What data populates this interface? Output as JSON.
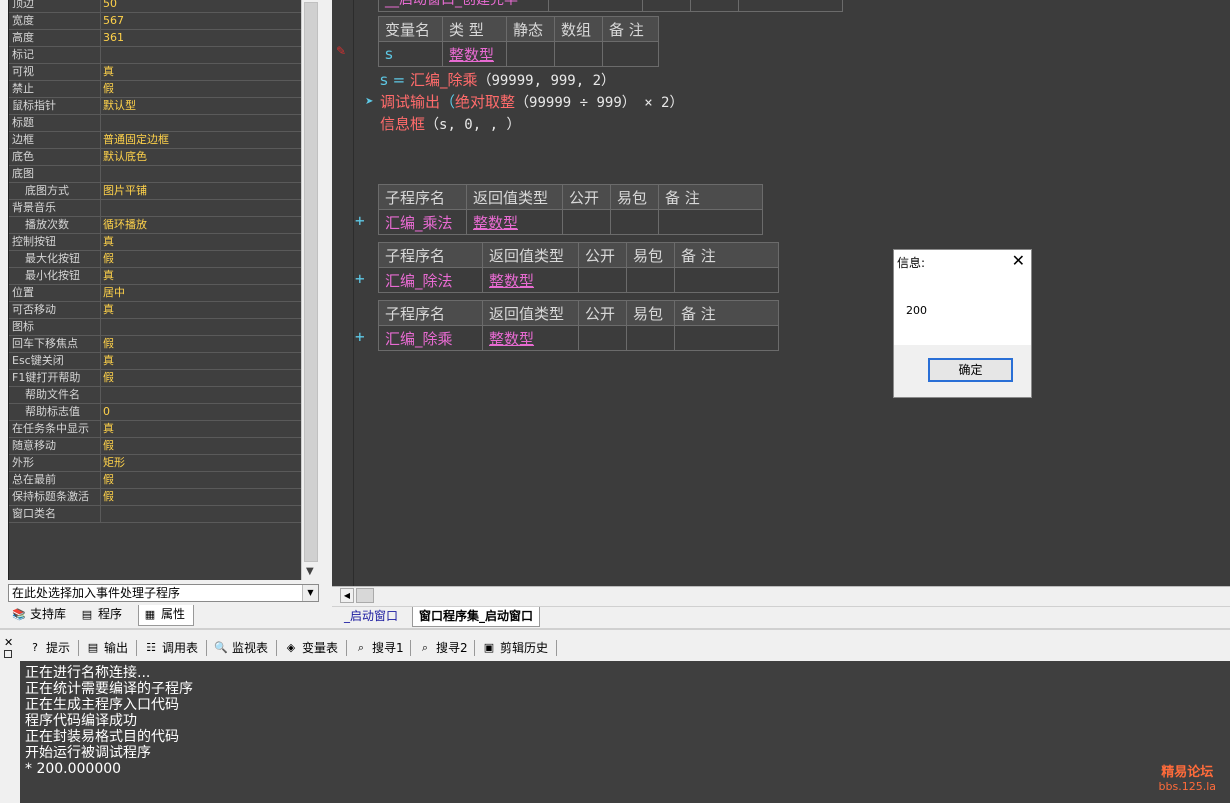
{
  "properties": [
    {
      "name": "顶边",
      "value": "50",
      "indent": false
    },
    {
      "name": "宽度",
      "value": "567",
      "indent": false
    },
    {
      "name": "高度",
      "value": "361",
      "indent": false
    },
    {
      "name": "标记",
      "value": "",
      "indent": false
    },
    {
      "name": "可视",
      "value": "真",
      "indent": false
    },
    {
      "name": "禁止",
      "value": "假",
      "indent": false
    },
    {
      "name": "鼠标指针",
      "value": "默认型",
      "indent": false
    },
    {
      "name": "标题",
      "value": "",
      "indent": false
    },
    {
      "name": "边框",
      "value": "普通固定边框",
      "indent": false
    },
    {
      "name": "底色",
      "value": "默认底色",
      "indent": false
    },
    {
      "name": "底图",
      "value": "",
      "indent": false
    },
    {
      "name": "底图方式",
      "value": "图片平铺",
      "indent": true
    },
    {
      "name": "背景音乐",
      "value": "",
      "indent": false
    },
    {
      "name": "播放次数",
      "value": "循环播放",
      "indent": true
    },
    {
      "name": "控制按钮",
      "value": "真",
      "indent": false
    },
    {
      "name": "最大化按钮",
      "value": "假",
      "indent": true
    },
    {
      "name": "最小化按钮",
      "value": "真",
      "indent": true
    },
    {
      "name": "位置",
      "value": "居中",
      "indent": false
    },
    {
      "name": "可否移动",
      "value": "真",
      "indent": false
    },
    {
      "name": "图标",
      "value": "",
      "indent": false
    },
    {
      "name": "回车下移焦点",
      "value": "假",
      "indent": false
    },
    {
      "name": "Esc键关闭",
      "value": "真",
      "indent": false
    },
    {
      "name": "F1键打开帮助",
      "value": "假",
      "indent": false
    },
    {
      "name": "帮助文件名",
      "value": "",
      "indent": true
    },
    {
      "name": "帮助标志值",
      "value": "0",
      "indent": true
    },
    {
      "name": "在任务条中显示",
      "value": "真",
      "indent": false
    },
    {
      "name": "随意移动",
      "value": "假",
      "indent": false
    },
    {
      "name": "外形",
      "value": "矩形",
      "indent": false
    },
    {
      "name": "总在最前",
      "value": "假",
      "indent": false
    },
    {
      "name": "保持标题条激活",
      "value": "假",
      "indent": false
    },
    {
      "name": "窗口类名",
      "value": "",
      "indent": false
    }
  ],
  "event_select": {
    "value": "在此处选择加入事件处理子程序"
  },
  "left_tabs": [
    {
      "label": "支持库",
      "icon": "library-icon"
    },
    {
      "label": "程序",
      "icon": "program-icon"
    },
    {
      "label": "属性",
      "icon": "property-icon"
    }
  ],
  "editor": {
    "top_row_text": "__启动窗口_创建完毕",
    "var_table": {
      "headers": [
        "变量名",
        "类 型",
        "静态",
        "数组",
        "备 注"
      ],
      "row": [
        "s",
        "整数型",
        "",
        "",
        ""
      ]
    },
    "code_lines": [
      {
        "var": "s",
        "op": " = ",
        "func": "汇编_除乘",
        "args": "（99999, 999, 2）"
      },
      {
        "prefix": "调试输出",
        "paren_open": "（",
        "func": "绝对取整",
        "args": "（99999 ÷ 999）",
        "rest": " × 2）"
      },
      {
        "prefix": "信息框",
        "args": "（s, 0, , ）"
      }
    ],
    "sub_tables": [
      {
        "headers": [
          "子程序名",
          "返回值类型",
          "公开",
          "易包",
          "备 注"
        ],
        "row": [
          "汇编_乘法",
          "整数型",
          "",
          "",
          ""
        ]
      },
      {
        "headers": [
          "子程序名",
          "返回值类型",
          "公开",
          "易包",
          "备 注"
        ],
        "row": [
          "汇编_除法",
          "整数型",
          "",
          "",
          ""
        ]
      },
      {
        "headers": [
          "子程序名",
          "返回值类型",
          "公开",
          "易包",
          "备 注"
        ],
        "row": [
          "汇编_除乘",
          "整数型",
          "",
          "",
          ""
        ]
      }
    ],
    "plus_sign": "+"
  },
  "editor_tabs": [
    {
      "label": "_启动窗口",
      "active": false
    },
    {
      "label": "窗口程序集_启动窗口",
      "active": true
    }
  ],
  "bottom_tabs": [
    {
      "label": "提示",
      "icon": "hint-icon"
    },
    {
      "label": "输出",
      "icon": "output-icon"
    },
    {
      "label": "调用表",
      "icon": "callstack-icon"
    },
    {
      "label": "监视表",
      "icon": "watch-icon"
    },
    {
      "label": "变量表",
      "icon": "variables-icon"
    },
    {
      "label": "搜寻1",
      "icon": "search1-icon"
    },
    {
      "label": "搜寻2",
      "icon": "search2-icon"
    },
    {
      "label": "剪辑历史",
      "icon": "clipboard-history-icon"
    }
  ],
  "output_lines": [
    "正在进行名称连接...",
    "正在统计需要编译的子程序",
    "正在生成主程序入口代码",
    "程序代码编译成功",
    "正在封装易格式目的代码",
    "开始运行被调试程序",
    "* 200.000000"
  ],
  "dialog": {
    "title": "信息:",
    "message": "200",
    "ok_label": "确定",
    "close_glyph": "✕"
  },
  "watermark": {
    "line1": "精易论坛",
    "line2": "bbs.125.la"
  },
  "colors": {
    "editor_bg": "#3c3c3c",
    "property_value": "#ffd24a",
    "keyword_func": "#ff6b6b",
    "identifier": "#5ec9e6",
    "subroutine_name": "#e86bd2"
  }
}
